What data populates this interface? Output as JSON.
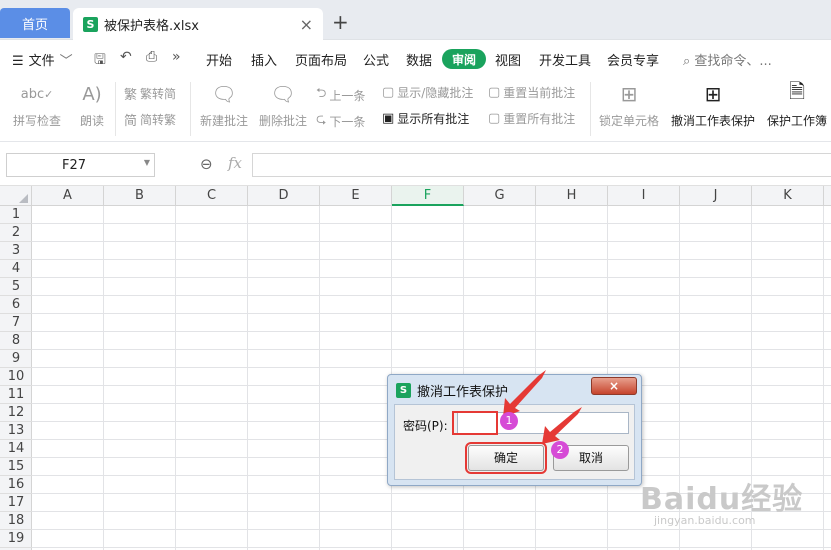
{
  "tabs": {
    "home": "首页",
    "file": "被保护表格.xlsx",
    "file_icon": "S",
    "close": "×",
    "new": "+"
  },
  "menu": {
    "file": "文件",
    "items": [
      "开始",
      "插入",
      "页面布局",
      "公式",
      "数据",
      "审阅",
      "视图",
      "开发工具",
      "会员专享"
    ],
    "active": "审阅",
    "search": "查找命令、..."
  },
  "ribbon": {
    "spell": "拼写检查",
    "read": "朗读",
    "to_trad": "繁转简",
    "to_simp": "简转繁",
    "new_comment": "新建批注",
    "delete_comment": "删除批注",
    "prev": "上一条",
    "next": "下一条",
    "toggle_comments": "显示/隐藏批注",
    "show_all_comments": "显示所有批注",
    "reset_current": "重置当前批注",
    "reset_all": "重置所有批注",
    "lock_cell": "锁定单元格",
    "unprotect_sheet": "撤消工作表保护",
    "protect_workbook": "保护工作簿"
  },
  "formula_bar": {
    "name_box": "F27",
    "fx": "fx",
    "value": ""
  },
  "grid": {
    "columns": [
      "A",
      "B",
      "C",
      "D",
      "E",
      "F",
      "G",
      "H",
      "I",
      "J",
      "K"
    ],
    "selected_column": "F",
    "rows": [
      "1",
      "2",
      "3",
      "4",
      "5",
      "6",
      "7",
      "8",
      "9",
      "10",
      "11",
      "12",
      "13",
      "14",
      "15",
      "16",
      "17",
      "18",
      "19"
    ]
  },
  "dialog": {
    "title": "撤消工作表保护",
    "icon": "S",
    "password_label": "密码(P):",
    "password_value": "",
    "ok": "确定",
    "cancel": "取消",
    "close": "×",
    "step1": "1",
    "step2": "2"
  },
  "watermark": {
    "brand": "Baidu经验",
    "url": "jingyan.baidu.com"
  },
  "colors": {
    "accent_green": "#1aa35d",
    "home_tab_blue": "#5b8ee6",
    "annotation_red": "#e53935",
    "badge_magenta": "#d64bd6"
  }
}
